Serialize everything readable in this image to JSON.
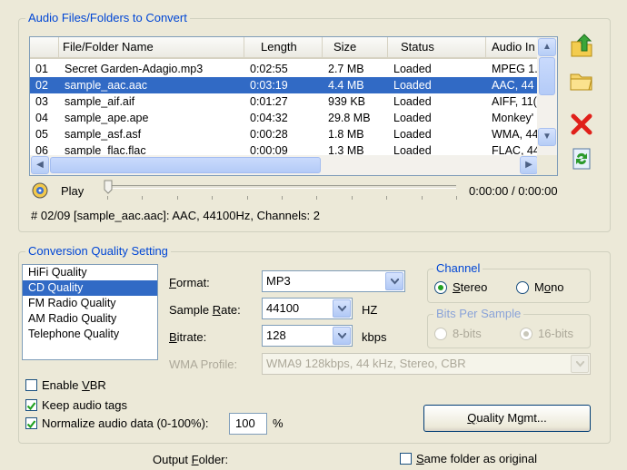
{
  "files_group": {
    "title": "Audio Files/Folders to Convert",
    "columns": [
      "",
      "File/Folder Name",
      "Length",
      "Size",
      "Status",
      "Audio In"
    ],
    "rows": [
      [
        "01",
        "Secret Garden-Adagio.mp3",
        "0:02:55",
        "2.7 MB",
        "Loaded",
        "MPEG 1."
      ],
      [
        "02",
        "sample_aac.aac",
        "0:03:19",
        "4.4 MB",
        "Loaded",
        "AAC, 44"
      ],
      [
        "03",
        "sample_aif.aif",
        "0:01:27",
        "939 KB",
        "Loaded",
        "AIFF, 11("
      ],
      [
        "04",
        "sample_ape.ape",
        "0:04:32",
        "29.8 MB",
        "Loaded",
        "Monkey'"
      ],
      [
        "05",
        "sample_asf.asf",
        "0:00:28",
        "1.8 MB",
        "Loaded",
        "WMA, 44"
      ],
      [
        "06",
        "sample_flac.flac",
        "0:00:09",
        "1.3 MB",
        "Loaded",
        "FLAC, 44"
      ]
    ],
    "selected_row": 1
  },
  "player": {
    "play_label": "Play",
    "time": "0:00:00 / 0:00:00",
    "progress": 0,
    "info": "# 02/09 [sample_aac.aac]: AAC, 44100Hz, Channels: 2"
  },
  "quality_group": {
    "title": "Conversion Quality Setting",
    "presets": [
      "HiFi Quality",
      "CD Quality",
      "FM Radio Quality",
      "AM Radio Quality",
      "Telephone Quality"
    ],
    "selected_preset": 1,
    "format_label": "Format:",
    "format_value": "MP3",
    "sample_rate_label": "Sample Rate:",
    "sample_rate_value": "44100",
    "sample_rate_unit": "HZ",
    "bitrate_label": "Bitrate:",
    "bitrate_value": "128",
    "bitrate_unit": "kbps",
    "wma_profile_label": "WMA Profile:",
    "wma_profile_value": "WMA9 128kbps, 44 kHz, Stereo, CBR",
    "channel_title": "Channel",
    "stereo_label": "Stereo",
    "mono_label": "Mono",
    "bits_title": "Bits Per Sample",
    "bits8_label": "8-bits",
    "bits16_label": "16-bits",
    "enable_vbr_label": "Enable VBR",
    "enable_vbr_checked": false,
    "keep_tags_label": "Keep audio tags",
    "keep_tags_checked": true,
    "normalize_label": "Normalize audio data (0-100%):",
    "normalize_checked": true,
    "normalize_value": "100",
    "normalize_unit": "%",
    "quality_mgmt_label": "Quality Mgmt..."
  },
  "output": {
    "folder_label": "Output Folder:",
    "same_folder_label": "Same folder as original",
    "same_folder_checked": false
  },
  "colors": {
    "selection": "#316ac5",
    "group_title": "#0046d5",
    "window_bg": "#ece9d8",
    "check_green": "#21a121"
  }
}
